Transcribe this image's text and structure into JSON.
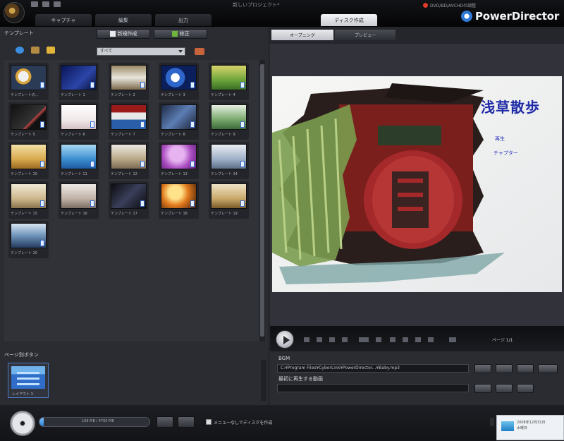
{
  "app": {
    "title": "新しいプロジェクト*",
    "recording_text": "DVD/BD/AVCHDの調整",
    "brand": "PowerDirector"
  },
  "tabs": [
    {
      "label": "キャプチャ",
      "active": false
    },
    {
      "label": "編集",
      "active": false
    },
    {
      "label": "出力",
      "active": false
    },
    {
      "label": "ディスク作成",
      "active": true
    }
  ],
  "left_panel": {
    "label": "テンプレート",
    "buttons": {
      "new": "新規作成",
      "edit": "修正"
    },
    "filter_value": "すべて",
    "templates": [
      "テンプレートの...",
      "テンプレート 1",
      "テンプレート 2",
      "テンプレート 3",
      "テンプレート 4",
      "テンプレート 5",
      "テンプレート 6",
      "テンプレート 7",
      "テンプレート 8",
      "テンプレート 9",
      "テンプレート 10",
      "テンプレート 11",
      "テンプレート 12",
      "テンプレート 13",
      "テンプレート 14",
      "テンプレート 15",
      "テンプレート 16",
      "テンプレート 17",
      "テンプレート 18",
      "テンプレート 19",
      "テンプレート 20"
    ],
    "page_section_label": "ページ別ボタン",
    "layout_label": "レイアウト 3"
  },
  "right_panel": {
    "tabs": {
      "opening": "オープニング",
      "preview": "プレビュー"
    },
    "menu_title": "浅草散歩",
    "menu_items": [
      "再生",
      "チャプター"
    ],
    "chapter_label": "ページ 1/1",
    "bgm_label": "BGM",
    "bgm_path": "C:¥Program Files¥CyberLink¥PowerDirector...¥Baby.mp3",
    "first_play_label": "最初に再生する動画",
    "first_play_value": ""
  },
  "status": {
    "capacity_text": "108 MB / 4700 MB",
    "capacity_fraction": 0.03,
    "no_menu_label": "メニューなしでディスクを作成",
    "toast_line1": "2008年12月31日",
    "toast_line2": "水曜日"
  },
  "colors": {
    "menu_title": "#1f2aa8",
    "brand_accent": "#2f79d6",
    "active_tab": "#f4f5f7"
  }
}
